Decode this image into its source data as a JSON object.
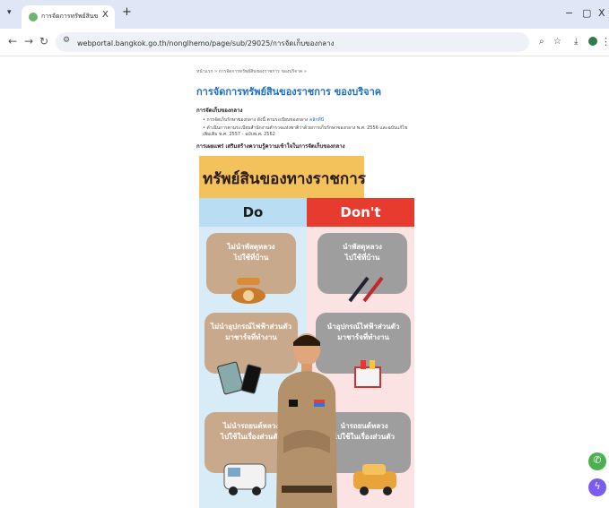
{
  "browser": {
    "tab_title": "การจัดการทรัพย์สินของราชการ ของ...",
    "tab_close": "X",
    "new_tab": "+",
    "url": "webportal.bangkok.go.th/nonglhemo/page/sub/29025/การจัดเก็บของกลาง",
    "window_controls": [
      "−",
      "▢",
      "X"
    ]
  },
  "page": {
    "breadcrumb": "หน้าแรก » การจัดการทรัพย์สินของราชการ ของบริจาค »",
    "title": "การจัดการทรัพย์สินของราชการ ของบริจาค",
    "section_heading": "การจัดเก็บของกลาง",
    "bullets": [
      {
        "text": "การจัดเก็บรักษาของกลาง ดังนี้ ตามระเบียบของกลาง",
        "link": "คลิกที่นี่"
      },
      {
        "text": "ดำเนินการตามระเบียบสำนักงานตำรวจแห่งชาติว่าด้วยการเก็บรักษาของกลาง พ.ศ. 2556 และฉบับแก้ไขเพิ่มเติม พ.ศ. 2557 - ฉบับพ.ศ. 2562",
        "link": ""
      }
    ],
    "lead": "การเผยแพร่ เสริมสร้างความรู้ความเข้าใจในการจัดเก็บของกลาง"
  },
  "infographic": {
    "title": "ทรัพย์สินของทางราชการ",
    "do_label": "Do",
    "dont_label": "Don't",
    "do_items": [
      "ไม่นำพัสดุหลวง\nไปใช้ที่บ้าน",
      "ไม่นำอุปกรณ์ไฟฟ้าส่วนตัว\nมาชาร์จที่ทำงาน",
      "ไม่นำรถยนต์หลวง\nไปใช้ในเรื่องส่วนตัว"
    ],
    "dont_items": [
      "นำพัสดุหลวง\nไปใช้ที่บ้าน",
      "นำอุปกรณ์ไฟฟ้าส่วนตัว\nมาชาร์จที่ทำงาน",
      "นำรถยนต์หลวง\nไปใช้ในเรื่องส่วนตัว"
    ]
  },
  "icons": [
    "tab-list-icon",
    "favicon-icon",
    "back-icon",
    "forward-icon",
    "reload-icon",
    "site-info-icon",
    "zoom-icon",
    "bookmark-star-icon",
    "download-icon",
    "profile-icon",
    "menu-icon",
    "phone-icon",
    "pen-icon",
    "tablet-phone-icon",
    "power-strip-icon",
    "van-icon",
    "car-icon",
    "line-chat-icon",
    "messenger-icon"
  ],
  "colors": {
    "title_band": "#f3c25c",
    "do_header": "#b9def3",
    "dont_header": "#e63b2e",
    "do_card": "#c9a98c",
    "dont_card": "#9e9e9e",
    "link": "#1e6fc4"
  }
}
